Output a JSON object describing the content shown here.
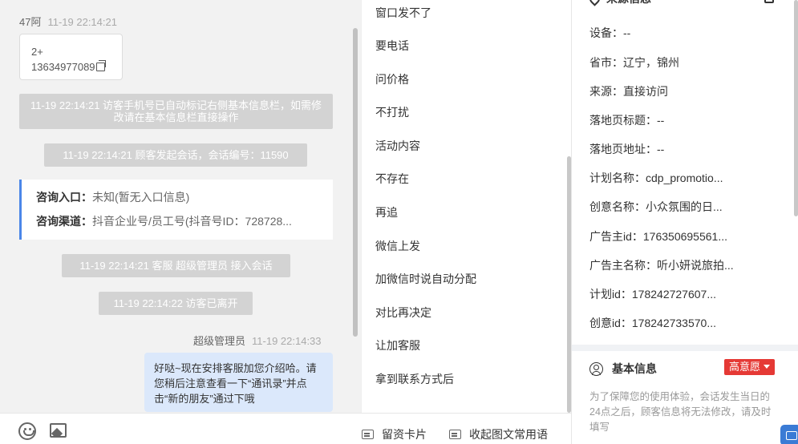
{
  "chat": {
    "sender1": {
      "name": "47阿",
      "time": "11-19 22:14:21"
    },
    "card": {
      "line1": "2+",
      "line2": "13634977089"
    },
    "system_msgs": [
      "11-19 22:14:21 访客手机号已自动标记右侧基本信息栏，如需修改请在基本信息栏直接操作",
      "11-19 22:14:21 顾客发起会话，会话编号：11590",
      "11-19 22:14:21 客服 超级管理员 接入会话",
      "11-19 22:14:22 访客已离开"
    ],
    "info": {
      "entry_label": "咨询入口：",
      "entry_value": "未知(暂无入口信息)",
      "channel_label": "咨询渠道：",
      "channel_value": "抖音企业号/员工号(抖音号ID：728728..."
    },
    "sender2": {
      "name": "超级管理员",
      "time": "11-19 22:14:33"
    },
    "bubble": "好哒~现在安排客服加您介绍哈。请您稍后注意查看一下“通讯录”并点击“新的朋友”通过下哦"
  },
  "footer": {
    "card_btn": "留资卡片",
    "collect_btn": "收起图文常用语"
  },
  "quick_replies": [
    "窗口发不了",
    "要电话",
    "问价格",
    "不打扰",
    "活动内容",
    "不存在",
    "再追",
    "微信上发",
    "加微信时说自动分配",
    "对比再决定",
    "让加客服",
    "拿到联系方式后"
  ],
  "source": {
    "title": "来源信息",
    "fields": [
      "设备：--",
      "省市：辽宁，锦州",
      "来源：直接访问",
      "落地页标题：--",
      "落地页地址：--",
      "计划名称：cdp_promotio...",
      "创意名称：小众氛围的日...",
      "广告主id：176350695561...",
      "广告主名称：听小妍说旅拍...",
      "计划id：178242727607...",
      "创意id：178242733570..."
    ]
  },
  "basic": {
    "title": "基本信息",
    "badge": "高意愿",
    "note": "为了保障您的使用体验，会话发生当日的24点之后，顾客信息将无法修改，请及时填写"
  },
  "colors": {
    "accent": "#4a86e8",
    "badge": "#e53935",
    "bubble": "#dbe8fb"
  }
}
